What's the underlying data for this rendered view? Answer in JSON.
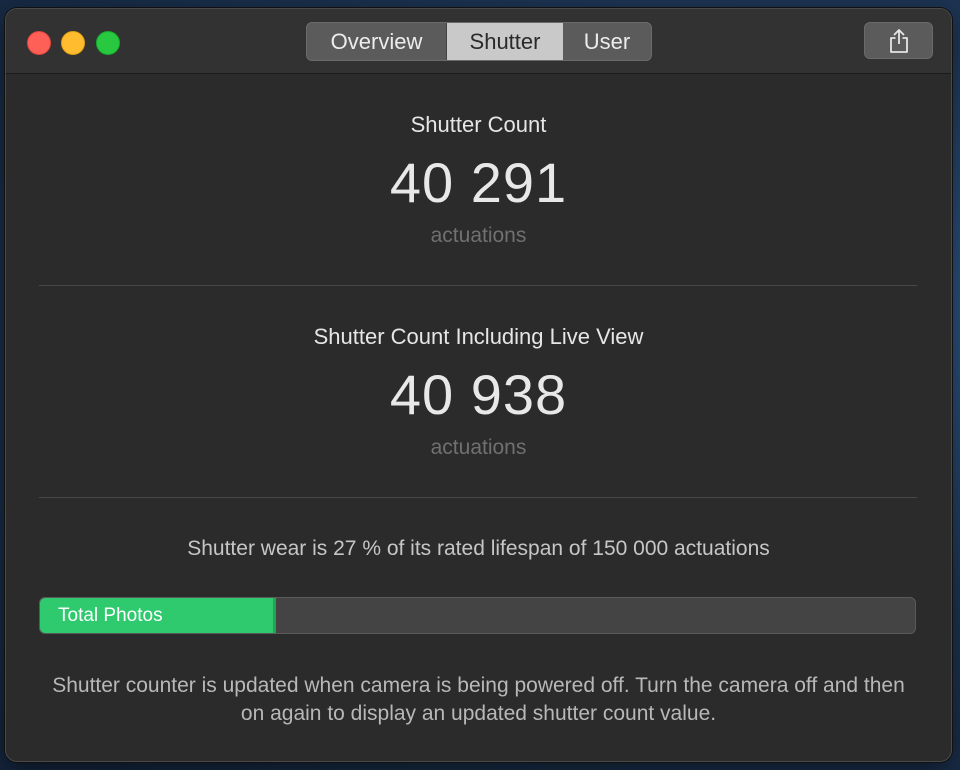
{
  "tabs": [
    {
      "label": "Overview",
      "selected": false
    },
    {
      "label": "Shutter",
      "selected": true
    },
    {
      "label": "User",
      "selected": false
    }
  ],
  "share_icon": "share-icon",
  "shutter_count": {
    "title": "Shutter Count",
    "value": "40 291",
    "unit": "actuations"
  },
  "shutter_count_live": {
    "title": "Shutter Count Including Live View",
    "value": "40 938",
    "unit": "actuations"
  },
  "wear_text": "Shutter wear is 27 % of its rated lifespan of 150 000 actuations",
  "progress": {
    "label": "Total Photos",
    "fraction": 0.27,
    "color": "#2fc96e"
  },
  "footer_text": "Shutter counter is updated when camera is being powered off. Turn the camera off and then on again to display an updated shutter count value."
}
